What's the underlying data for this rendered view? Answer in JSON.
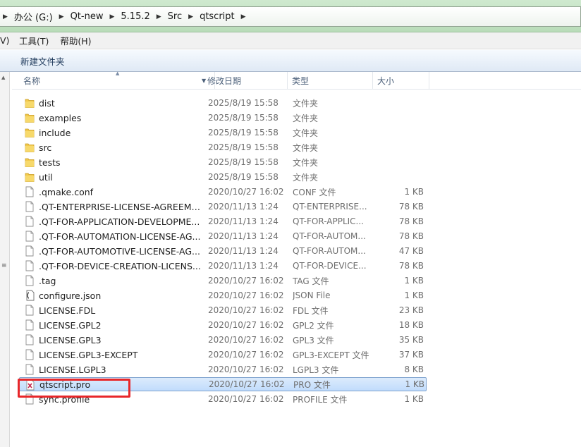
{
  "breadcrumb": {
    "items": [
      {
        "label": "办公 (G:)"
      },
      {
        "label": "Qt-new"
      },
      {
        "label": "5.15.2"
      },
      {
        "label": "Src"
      },
      {
        "label": "qtscript"
      }
    ]
  },
  "menubar": {
    "items": [
      {
        "label": "V)"
      },
      {
        "label": "工具(T)"
      },
      {
        "label": "帮助(H)"
      }
    ]
  },
  "toolbar": {
    "new_folder_label": "新建文件夹"
  },
  "columns": {
    "name": "名称",
    "date": "修改日期",
    "type": "类型",
    "size": "大小"
  },
  "files": [
    {
      "name": "dist",
      "date": "2025/8/19 15:58",
      "type": "文件夹",
      "size": "",
      "icon": "folder-icon"
    },
    {
      "name": "examples",
      "date": "2025/8/19 15:58",
      "type": "文件夹",
      "size": "",
      "icon": "folder-icon"
    },
    {
      "name": "include",
      "date": "2025/8/19 15:58",
      "type": "文件夹",
      "size": "",
      "icon": "folder-icon"
    },
    {
      "name": "src",
      "date": "2025/8/19 15:58",
      "type": "文件夹",
      "size": "",
      "icon": "folder-icon"
    },
    {
      "name": "tests",
      "date": "2025/8/19 15:58",
      "type": "文件夹",
      "size": "",
      "icon": "folder-icon"
    },
    {
      "name": "util",
      "date": "2025/8/19 15:58",
      "type": "文件夹",
      "size": "",
      "icon": "folder-icon"
    },
    {
      "name": ".qmake.conf",
      "date": "2020/10/27 16:02",
      "type": "CONF 文件",
      "size": "1 KB",
      "icon": "file-icon"
    },
    {
      "name": ".QT-ENTERPRISE-LICENSE-AGREEME...",
      "date": "2020/11/13 1:24",
      "type": "QT-ENTERPRISE...",
      "size": "78 KB",
      "icon": "file-icon"
    },
    {
      "name": ".QT-FOR-APPLICATION-DEVELOPME...",
      "date": "2020/11/13 1:24",
      "type": "QT-FOR-APPLIC...",
      "size": "78 KB",
      "icon": "file-icon"
    },
    {
      "name": ".QT-FOR-AUTOMATION-LICENSE-AG...",
      "date": "2020/11/13 1:24",
      "type": "QT-FOR-AUTOM...",
      "size": "78 KB",
      "icon": "file-icon"
    },
    {
      "name": ".QT-FOR-AUTOMOTIVE-LICENSE-AG...",
      "date": "2020/11/13 1:24",
      "type": "QT-FOR-AUTOM...",
      "size": "47 KB",
      "icon": "file-icon"
    },
    {
      "name": ".QT-FOR-DEVICE-CREATION-LICENS...",
      "date": "2020/11/13 1:24",
      "type": "QT-FOR-DEVICE...",
      "size": "78 KB",
      "icon": "file-icon"
    },
    {
      "name": ".tag",
      "date": "2020/10/27 16:02",
      "type": "TAG 文件",
      "size": "1 KB",
      "icon": "file-icon"
    },
    {
      "name": "configure.json",
      "date": "2020/10/27 16:02",
      "type": "JSON File",
      "size": "1 KB",
      "icon": "json-file-icon"
    },
    {
      "name": "LICENSE.FDL",
      "date": "2020/10/27 16:02",
      "type": "FDL 文件",
      "size": "23 KB",
      "icon": "file-icon"
    },
    {
      "name": "LICENSE.GPL2",
      "date": "2020/10/27 16:02",
      "type": "GPL2 文件",
      "size": "18 KB",
      "icon": "file-icon"
    },
    {
      "name": "LICENSE.GPL3",
      "date": "2020/10/27 16:02",
      "type": "GPL3 文件",
      "size": "35 KB",
      "icon": "file-icon"
    },
    {
      "name": "LICENSE.GPL3-EXCEPT",
      "date": "2020/10/27 16:02",
      "type": "GPL3-EXCEPT 文件",
      "size": "37 KB",
      "icon": "file-icon"
    },
    {
      "name": "LICENSE.LGPL3",
      "date": "2020/10/27 16:02",
      "type": "LGPL3 文件",
      "size": "8 KB",
      "icon": "file-icon"
    },
    {
      "name": "qtscript.pro",
      "date": "2020/10/27 16:02",
      "type": "PRO 文件",
      "size": "1 KB",
      "icon": "qt-project-icon",
      "selected": true
    },
    {
      "name": "sync.profile",
      "date": "2020/10/27 16:02",
      "type": "PROFILE 文件",
      "size": "1 KB",
      "icon": "file-icon"
    }
  ],
  "colors": {
    "addressbar_bg": "#c4e2c4",
    "selection_bg": "#cce3fc",
    "selection_border": "#7da2ce",
    "highlight_box": "#e8272a",
    "folder": "#f2c94c"
  }
}
